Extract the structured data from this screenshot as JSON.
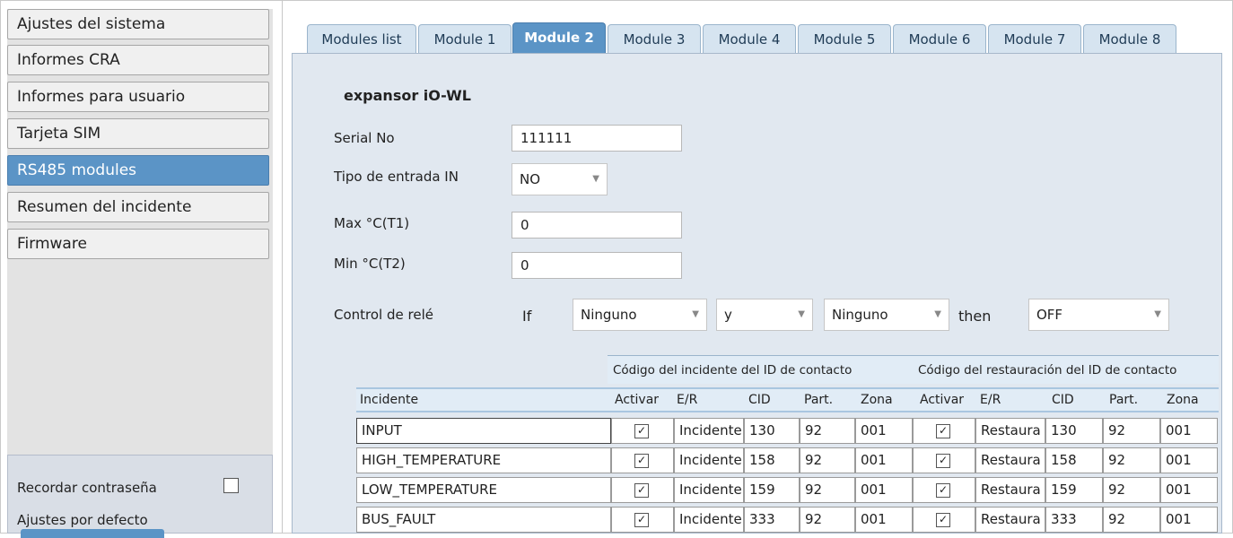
{
  "sidebar": {
    "items": [
      {
        "label": "Ajustes del sistema"
      },
      {
        "label": "Informes CRA"
      },
      {
        "label": "Informes para usuario"
      },
      {
        "label": "Tarjeta SIM"
      },
      {
        "label": "RS485 modules"
      },
      {
        "label": "Resumen del incidente"
      },
      {
        "label": "Firmware"
      }
    ],
    "active_index": 4,
    "remember_password_label": "Recordar contraseña",
    "defaults_label": "Ajustes por defecto"
  },
  "tabs": [
    {
      "label": "Modules list"
    },
    {
      "label": "Module 1"
    },
    {
      "label": "Module 2"
    },
    {
      "label": "Module 3"
    },
    {
      "label": "Module 4"
    },
    {
      "label": "Module 5"
    },
    {
      "label": "Module 6"
    },
    {
      "label": "Module 7"
    },
    {
      "label": "Module 8"
    }
  ],
  "module": {
    "title": "expansor iO-WL",
    "serial_label": "Serial No",
    "serial_value": "111111",
    "input_type_label": "Tipo de entrada IN",
    "input_type_value": "NO",
    "max_label": "Max °C(T1)",
    "max_value": "0",
    "min_label": "Min °C(T2)",
    "min_value": "0",
    "relay_label": "Control de relé",
    "if_label": "If",
    "cond1": "Ninguno",
    "op": "y",
    "cond2": "Ninguno",
    "then_label": "then",
    "action": "OFF"
  },
  "table": {
    "group1": "Código del incidente del ID de contacto",
    "group2": "Código del restauración del ID de contacto",
    "columns": [
      "Incidente",
      "Activar",
      "E/R",
      "CID",
      "Part.",
      "Zona",
      "Activar",
      "E/R",
      "CID",
      "Part.",
      "Zona"
    ],
    "rows": [
      {
        "name": "INPUT",
        "er1": "Incidente",
        "cid1": "130",
        "part1": "92",
        "zona1": "001",
        "er2": "Restaura",
        "cid2": "130",
        "part2": "92",
        "zona2": "001"
      },
      {
        "name": "HIGH_TEMPERATURE",
        "er1": "Incidente",
        "cid1": "158",
        "part1": "92",
        "zona1": "001",
        "er2": "Restaura",
        "cid2": "158",
        "part2": "92",
        "zona2": "001"
      },
      {
        "name": "LOW_TEMPERATURE",
        "er1": "Incidente",
        "cid1": "159",
        "part1": "92",
        "zona1": "001",
        "er2": "Restaura",
        "cid2": "159",
        "part2": "92",
        "zona2": "001"
      },
      {
        "name": "BUS_FAULT",
        "er1": "Incidente",
        "cid1": "333",
        "part1": "92",
        "zona1": "001",
        "er2": "Restaura",
        "cid2": "333",
        "part2": "92",
        "zona2": "001"
      }
    ]
  }
}
